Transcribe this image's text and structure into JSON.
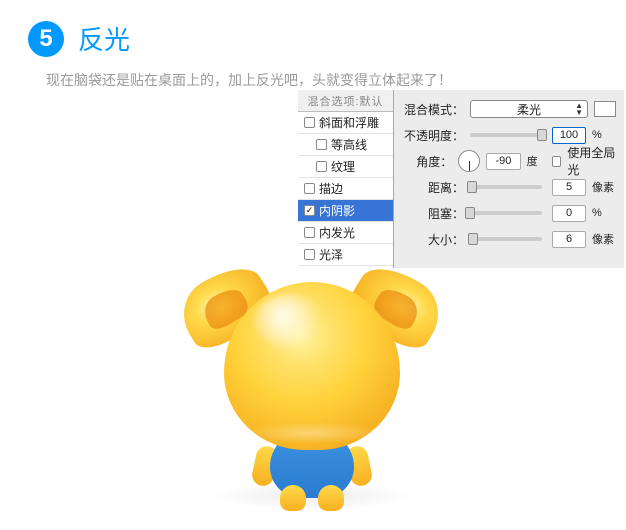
{
  "step": {
    "number": "5",
    "title": "反光"
  },
  "description": "现在脑袋还是贴在桌面上的，加上反光吧，头就变得立体起来了！",
  "layerStyle": {
    "panelHeader": "混合选项:默认",
    "effects": [
      {
        "label": "斜面和浮雕",
        "checked": false,
        "indent": false
      },
      {
        "label": "等高线",
        "checked": false,
        "indent": true
      },
      {
        "label": "纹理",
        "checked": false,
        "indent": true
      },
      {
        "label": "描边",
        "checked": false,
        "indent": false
      },
      {
        "label": "内阴影",
        "checked": true,
        "indent": false,
        "selected": true
      },
      {
        "label": "内发光",
        "checked": false,
        "indent": false
      },
      {
        "label": "光泽",
        "checked": false,
        "indent": false
      }
    ],
    "fields": {
      "blendModeLabel": "混合模式：",
      "blendModeValue": "柔光",
      "opacityLabel": "不透明度：",
      "opacityValue": "100",
      "opacityUnit": "%",
      "angleLabel": "角度：",
      "angleValue": "-90",
      "angleUnit": "度",
      "globalLightLabel": "使用全局光",
      "globalLightChecked": false,
      "distanceLabel": "距离：",
      "distanceValue": "5",
      "distanceUnit": "像素",
      "spreadLabel": "阻塞：",
      "spreadValue": "0",
      "spreadUnit": "%",
      "sizeLabel": "大小：",
      "sizeValue": "6",
      "sizeUnit": "像素"
    }
  },
  "sliderPositions": {
    "opacity": 100,
    "distance": 3,
    "spread": 0,
    "size": 4
  }
}
